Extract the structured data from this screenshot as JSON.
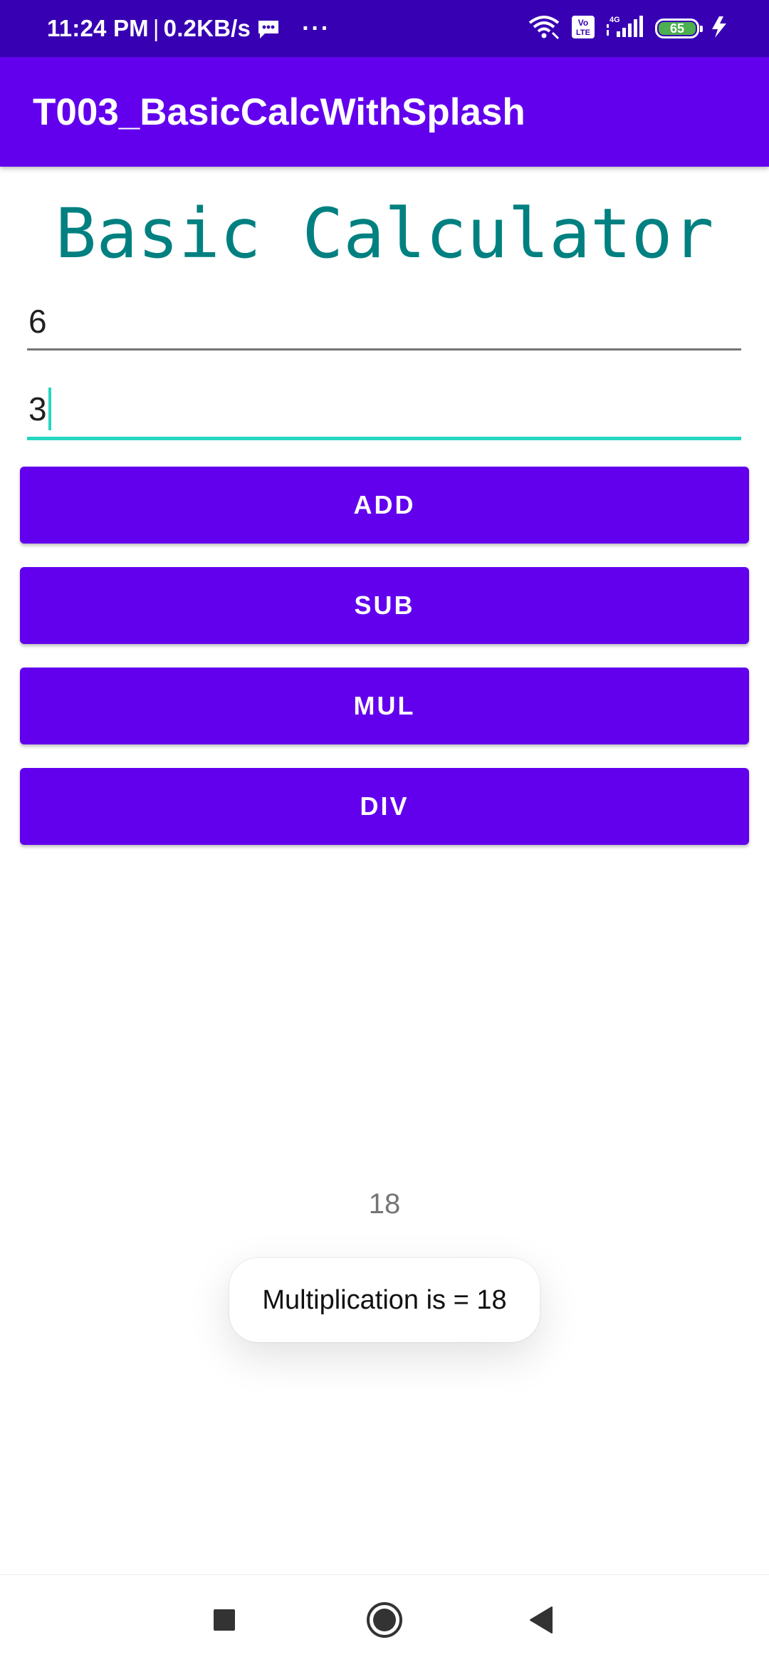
{
  "status_bar": {
    "time": "11:24 PM",
    "separator": "|",
    "net_speed": "0.2KB/s",
    "more_indicator": "···",
    "battery_level": "65",
    "icons": [
      "message-icon",
      "wifi-icon",
      "volte-icon",
      "4g-signal-icon",
      "battery-icon",
      "charging-icon"
    ],
    "colors": {
      "background": "#3700b3",
      "battery_fill": "#4caf50"
    }
  },
  "toolbar": {
    "title": "T003_BasicCalcWithSplash",
    "color": "#6200ee"
  },
  "heading": {
    "text": "Basic Calculator",
    "color": "#008080"
  },
  "inputs": {
    "first_number": "6",
    "second_number": "3",
    "focused_underline_color": "#26d7c0"
  },
  "buttons": {
    "add": "ADD",
    "sub": "SUB",
    "mul": "MUL",
    "div": "DIV",
    "color": "#6200ee"
  },
  "result": {
    "value": "18"
  },
  "toast": {
    "message": "Multiplication is = 18"
  },
  "nav_bar": {
    "icons": [
      "recents-square-icon",
      "home-circle-icon",
      "back-triangle-icon"
    ]
  }
}
